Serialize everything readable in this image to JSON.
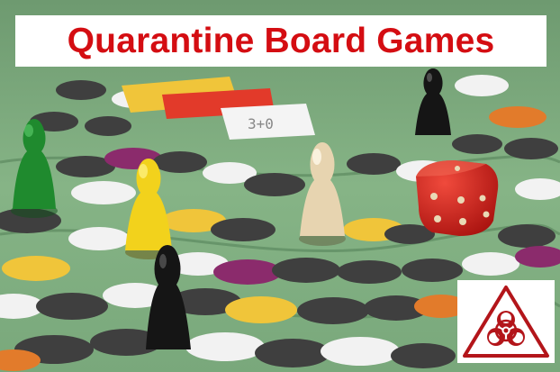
{
  "title": {
    "text": "Quarantine Board Games",
    "color": "#d40d12"
  },
  "board": {
    "felt_color": "#7fb07f",
    "space_colors": [
      "#3f3f3f",
      "#f2f2f2",
      "#f0c53a",
      "#8b2b6c",
      "#e27b2b"
    ]
  },
  "pieces": [
    {
      "kind": "pawn",
      "color": "#1f8a2e"
    },
    {
      "kind": "pawn",
      "color": "#f2d21c"
    },
    {
      "kind": "pawn",
      "color": "#e7d4b0"
    },
    {
      "kind": "pawn",
      "color": "#151515"
    },
    {
      "kind": "pawn",
      "color": "#151515"
    },
    {
      "kind": "die",
      "color": "#d6221c"
    }
  ],
  "badge": {
    "icon": "biohazard-icon",
    "color": "#b3151a"
  }
}
